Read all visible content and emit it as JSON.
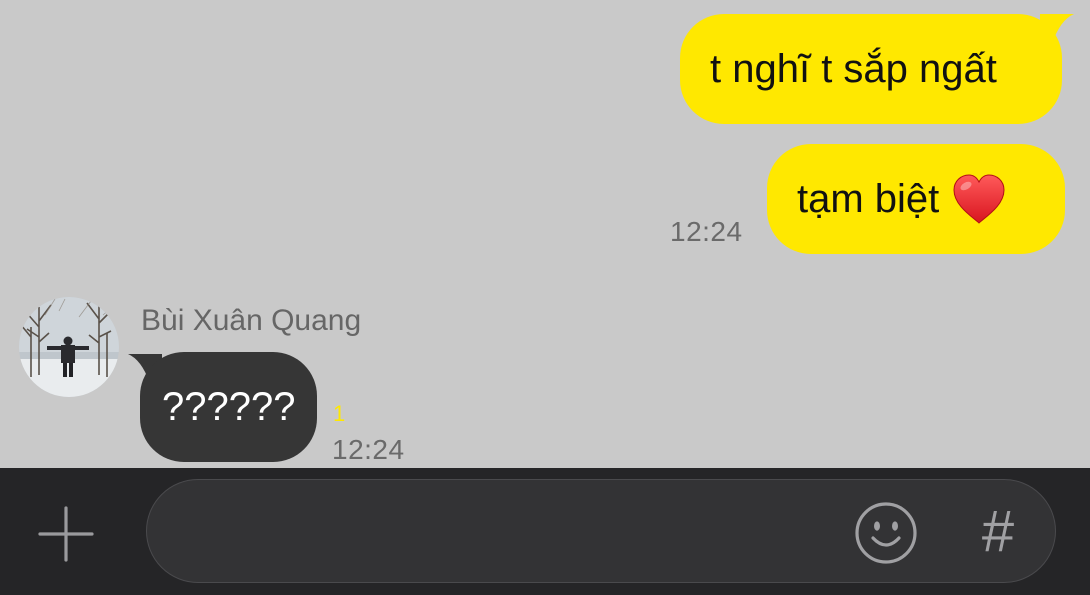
{
  "messages": {
    "outgoing_1": {
      "text": "t nghĩ t sắp ngất"
    },
    "outgoing_2": {
      "text": "tạm biệt",
      "emoji": "red-heart",
      "time": "12:24"
    },
    "incoming_1": {
      "sender": "Bùi Xuân Quang",
      "text": "??????",
      "unread_count": "1",
      "time": "12:24"
    }
  },
  "input_bar": {
    "input_value": "",
    "plus_icon": "plus-icon",
    "emoji_icon": "smiley-icon",
    "hash_icon": "hash-icon",
    "hash_symbol": "#"
  },
  "colors": {
    "chat_background": "#c9c9c9",
    "outgoing_bubble": "#ffe800",
    "incoming_bubble": "#363636",
    "unread_count": "#ffe800",
    "input_bar_background": "#252527"
  }
}
